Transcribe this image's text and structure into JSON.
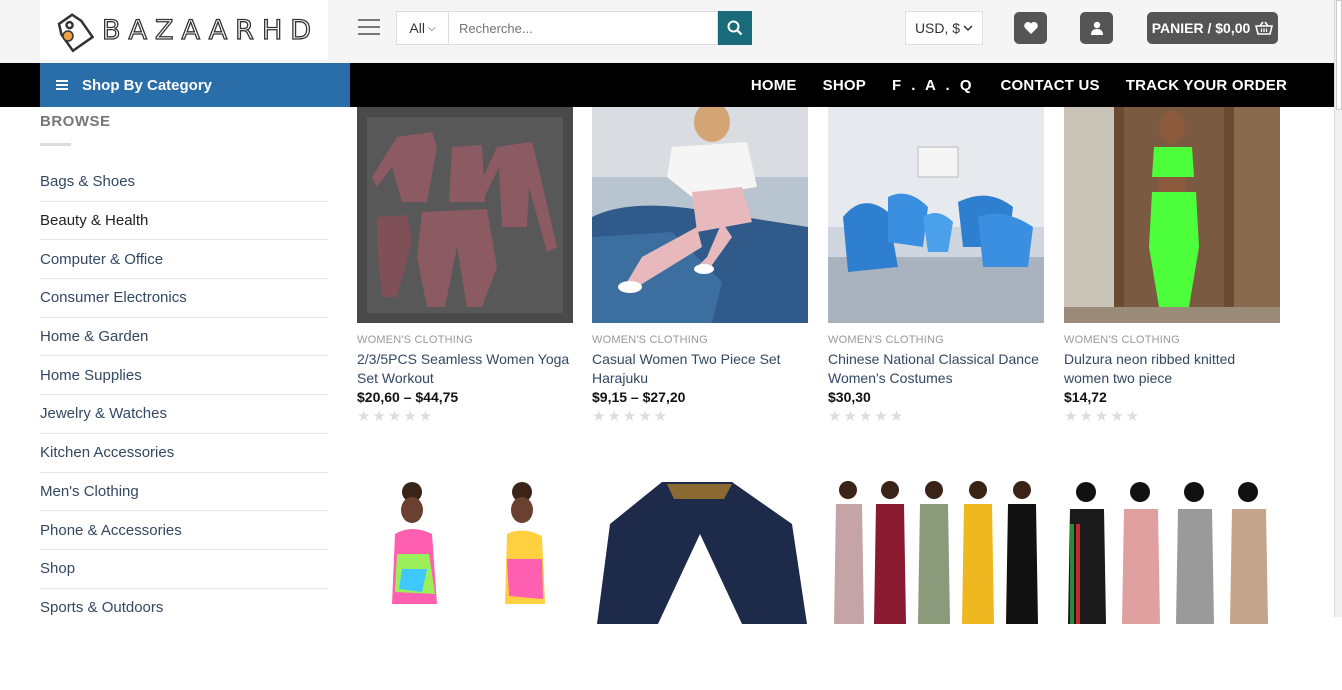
{
  "header": {
    "logo_text": "BAZAARHD",
    "search": {
      "category": "All",
      "placeholder": "Recherche..."
    },
    "currency": "USD, $",
    "cart_label": "PANIER / $0,00"
  },
  "nav": {
    "shop_by_category": "Shop By Category",
    "links": [
      "HOME",
      "SHOP",
      "F . A . Q",
      "CONTACT US",
      "TRACK YOUR ORDER"
    ]
  },
  "sidebar": {
    "title": "BROWSE",
    "items": [
      "Bags & Shoes",
      "Beauty & Health",
      "Computer & Office",
      "Consumer Electronics",
      "Home & Garden",
      "Home Supplies",
      "Jewelry & Watches",
      "Kitchen Accessories",
      "Men's Clothing",
      "Phone & Accessories",
      "Shop",
      "Sports & Outdoors"
    ]
  },
  "products": [
    {
      "category": "WOMEN'S CLOTHING",
      "name": "2/3/5PCS Seamless Women Yoga Set Workout",
      "price": "$20,60 – $44,75",
      "rating": 0
    },
    {
      "category": "WOMEN'S CLOTHING",
      "name": "Casual Women Two Piece Set Harajuku",
      "price": "$9,15 – $27,20",
      "rating": 0
    },
    {
      "category": "WOMEN'S CLOTHING",
      "name": "Chinese National Classical Dance Women's Costumes",
      "price": "$30,30",
      "rating": 0
    },
    {
      "category": "WOMEN'S CLOTHING",
      "name": "Dulzura neon ribbed knitted women two piece",
      "price": "$14,72",
      "rating": 0
    }
  ],
  "colors": {
    "accent": "#2a6ea9",
    "nav_bg": "#000000",
    "search_btn": "#1a6b7a",
    "icon_btn": "#555555"
  }
}
